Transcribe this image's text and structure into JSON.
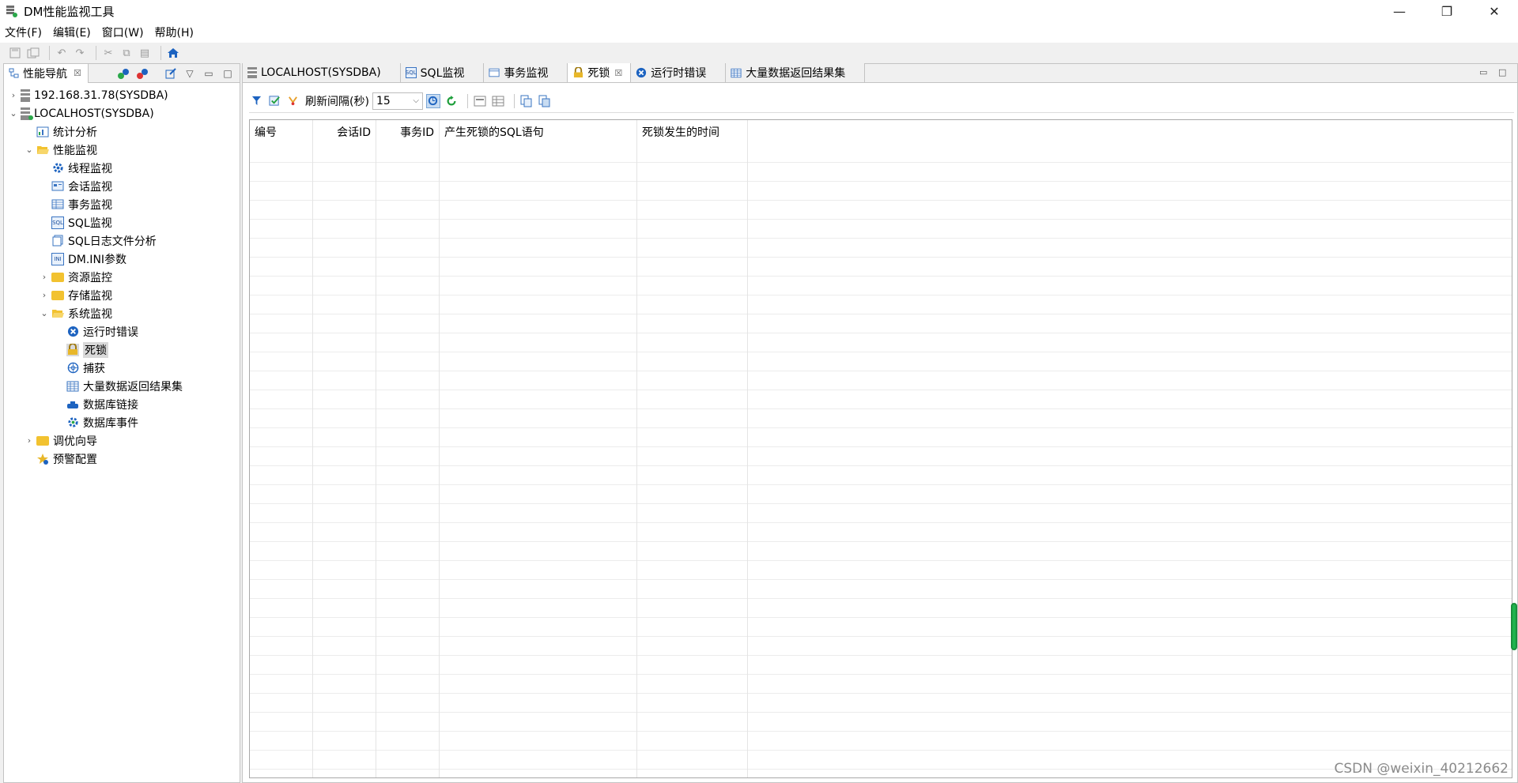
{
  "window": {
    "title": "DM性能监视工具",
    "controls": {
      "minimize": "—",
      "restore": "❐",
      "close": "✕"
    }
  },
  "menu": [
    {
      "label": "文件(F)"
    },
    {
      "label": "编辑(E)"
    },
    {
      "label": "窗口(W)"
    },
    {
      "label": "帮助(H)"
    }
  ],
  "left_panel": {
    "tab_label": "性能导航",
    "tab_close": "☒",
    "tree": [
      {
        "label": "192.168.31.78(SYSDBA)",
        "arrow": "›",
        "icon": "database-icon",
        "level": 0
      },
      {
        "label": "LOCALHOST(SYSDBA)",
        "arrow": "⌄",
        "icon": "database-connected-icon",
        "level": 0
      },
      {
        "label": "统计分析",
        "arrow": "",
        "icon": "statistics-icon",
        "level": 1
      },
      {
        "label": "性能监视",
        "arrow": "⌄",
        "icon": "folder-open-icon",
        "level": 1
      },
      {
        "label": "线程监视",
        "arrow": "",
        "icon": "gear-icon",
        "level": 2
      },
      {
        "label": "会话监视",
        "arrow": "",
        "icon": "session-icon",
        "level": 2
      },
      {
        "label": "事务监视",
        "arrow": "",
        "icon": "transaction-icon",
        "level": 2
      },
      {
        "label": "SQL监视",
        "arrow": "",
        "icon": "sql-icon",
        "level": 2
      },
      {
        "label": "SQL日志文件分析",
        "arrow": "",
        "icon": "log-file-icon",
        "level": 2
      },
      {
        "label": "DM.INI参数",
        "arrow": "",
        "icon": "ini-icon",
        "level": 2
      },
      {
        "label": "资源监控",
        "arrow": "›",
        "icon": "folder-icon",
        "level": 2
      },
      {
        "label": "存储监视",
        "arrow": "›",
        "icon": "folder-icon",
        "level": 2
      },
      {
        "label": "系统监视",
        "arrow": "⌄",
        "icon": "folder-open-icon",
        "level": 2
      },
      {
        "label": "运行时错误",
        "arrow": "",
        "icon": "error-icon",
        "level": 3
      },
      {
        "label": "死锁",
        "arrow": "",
        "icon": "lock-icon",
        "level": 3,
        "selected": true
      },
      {
        "label": "捕获",
        "arrow": "",
        "icon": "capture-icon",
        "level": 3
      },
      {
        "label": "大量数据返回结果集",
        "arrow": "",
        "icon": "table-icon",
        "level": 3
      },
      {
        "label": "数据库链接",
        "arrow": "",
        "icon": "link-icon",
        "level": 3
      },
      {
        "label": "数据库事件",
        "arrow": "",
        "icon": "gear-icon",
        "level": 3
      },
      {
        "label": "调优向导",
        "arrow": "›",
        "icon": "folder-icon",
        "level": 1
      },
      {
        "label": "预警配置",
        "arrow": "",
        "icon": "alert-config-icon",
        "level": 1
      }
    ]
  },
  "editor": {
    "tabs": [
      {
        "label": "LOCALHOST(SYSDBA)",
        "icon": "database-icon",
        "active": false
      },
      {
        "label": "SQL监视",
        "icon": "sql-icon",
        "active": false
      },
      {
        "label": "事务监视",
        "icon": "transaction-icon",
        "active": false
      },
      {
        "label": "死锁",
        "icon": "lock-icon",
        "active": true,
        "close": "☒"
      },
      {
        "label": "运行时错误",
        "icon": "error-icon",
        "active": false
      },
      {
        "label": "大量数据返回结果集",
        "icon": "table-icon",
        "active": false
      }
    ],
    "toolbar": {
      "refresh_label": "刷新间隔(秒)",
      "refresh_value": "15"
    },
    "table": {
      "columns": [
        {
          "label": "编号",
          "align": "left"
        },
        {
          "label": "会话ID",
          "align": "right"
        },
        {
          "label": "事务ID",
          "align": "right"
        },
        {
          "label": "产生死锁的SQL语句",
          "align": "left"
        },
        {
          "label": "死锁发生的时间",
          "align": "left"
        }
      ],
      "rows": []
    }
  },
  "watermark": "CSDN @weixin_40212662",
  "colors": {
    "accent_blue": "#1d63c0",
    "green": "#1f9f3c",
    "folder": "#f2c230",
    "selection": "#d9d9d9"
  }
}
